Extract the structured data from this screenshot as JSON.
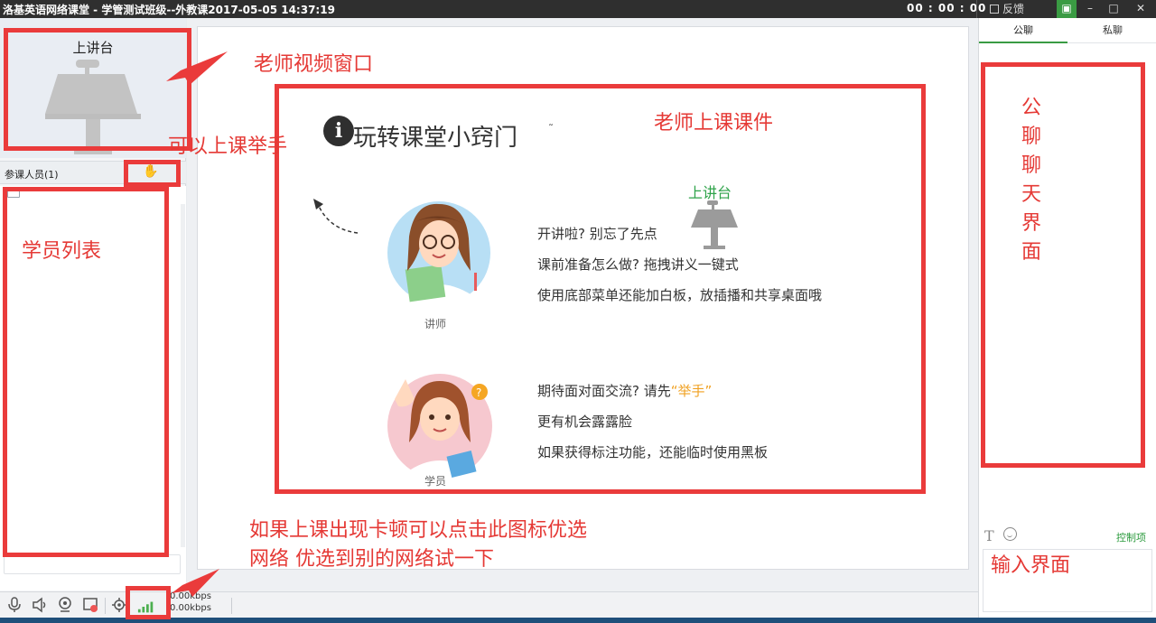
{
  "window": {
    "title": "洛基英语网络课堂 - 学管测试班级--外教课2017-05-05 14:37:19",
    "timer": "00 : 00 : 00",
    "feedback_label": "反馈"
  },
  "left_panel": {
    "stage_label": "上讲台",
    "participants_label": "参课人员(1)",
    "student_placeholder": "-"
  },
  "chat": {
    "tabs": [
      "公聊",
      "私聊"
    ],
    "control_label": "控制项"
  },
  "bottom_bar": {
    "upload_kbps": "0.00kbps",
    "download_kbps": "0.00kbps"
  },
  "slide": {
    "title": "玩转课堂小窍门",
    "stage_label": "上讲台",
    "teacher_caption": "讲师",
    "student_caption": "学员",
    "teacher_lines": [
      "开讲啦? 别忘了先点",
      "课前准备怎么做? 拖拽讲义一键式",
      "使用底部菜单还能加白板，放插播和共享桌面哦"
    ],
    "student_line1_prefix": "期待面对面交流? 请先",
    "student_line1_highlight": "“举手”",
    "student_lines": [
      "更有机会露露脸",
      "如果获得标注功能，还能临时使用黑板"
    ]
  },
  "annotations": {
    "teacher_video": "老师视频窗口",
    "raise_hand": "可以上课举手",
    "student_list": "学员列表",
    "courseware": "老师上课课件",
    "public_chat": [
      "公",
      "聊",
      "聊",
      "天",
      "界",
      "面"
    ],
    "input_area": "输入界面",
    "network_line1": "如果上课出现卡顿可以点击此图标优选",
    "network_line2": "网络 优选到别的网络试一下"
  },
  "colors": {
    "annotation_red": "#ea3b3b",
    "accent_green": "#3a9b43",
    "highlight_orange": "#f0a020"
  }
}
